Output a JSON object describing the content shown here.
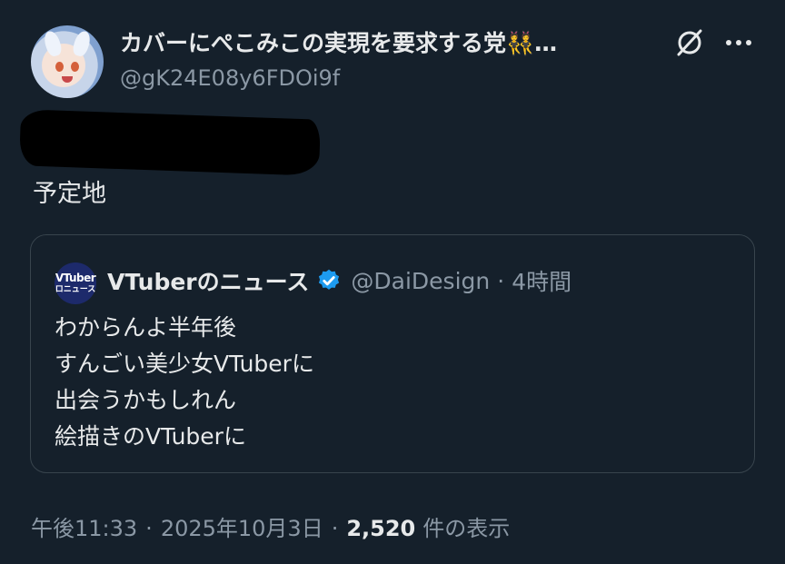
{
  "author": {
    "display_name": "カバーにぺこみこの実現を要求する党👯…",
    "handle": "@gK24E08y6FDOi9f",
    "avatar_icon": "anime-rabbit-girl-avatar"
  },
  "header_actions": {
    "grok_icon": "grok-slash-icon",
    "more_icon": "more-dots-icon"
  },
  "post": {
    "redacted_icon": "redaction-scribble",
    "text_line": "予定地"
  },
  "quoted_post": {
    "avatar_line1": "VTuber",
    "avatar_line2": "ロニュース",
    "name": "VTuberのニュース",
    "verified_icon": "verified-badge-icon",
    "handle": "@DaiDesign",
    "separator": "·",
    "time": "4時間",
    "lines": [
      "わからんよ半年後",
      "すんごい美少女VTuberに",
      "出会うかもしれん",
      "絵描きのVTuberに"
    ]
  },
  "meta": {
    "time": "午後11:33",
    "separator": "·",
    "date": "2025年10月3日",
    "views_count": "2,520",
    "views_label": "件の表示"
  },
  "colors": {
    "background": "#15202b",
    "text": "#e7e9ea",
    "secondary": "#8b98a5",
    "border": "#38444d",
    "verified": "#1d9bf0"
  }
}
